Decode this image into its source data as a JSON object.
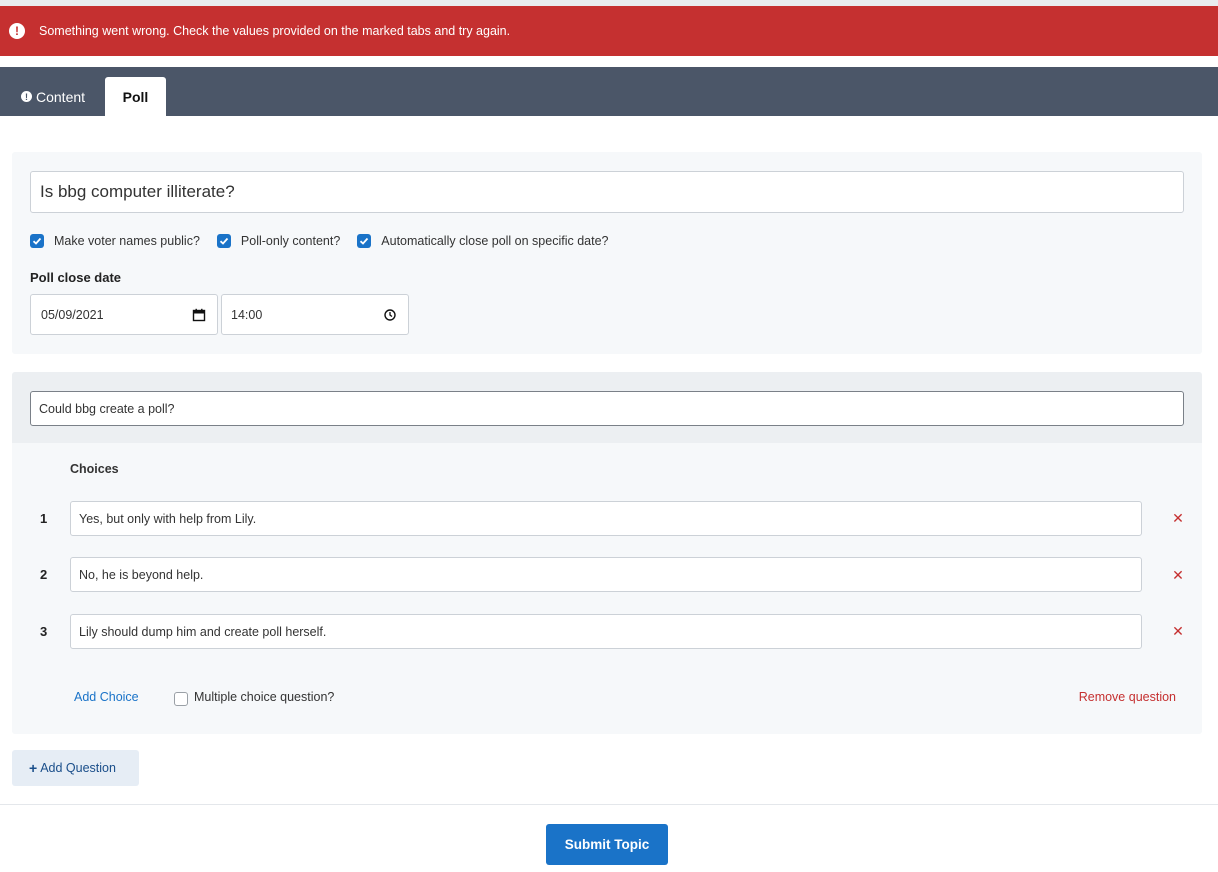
{
  "alert": {
    "message": "Something went wrong. Check the values provided on the marked tabs and try again."
  },
  "tabs": [
    {
      "label": "Content",
      "error": true
    },
    {
      "label": "Poll",
      "active": true
    }
  ],
  "poll": {
    "title": "Is bbg computer illiterate?",
    "options": [
      {
        "label": "Make voter names public?",
        "checked": true
      },
      {
        "label": "Poll-only content?",
        "checked": true
      },
      {
        "label": "Automatically close poll on specific date?",
        "checked": true
      }
    ],
    "close_date_label": "Poll close date",
    "close_date": "05/09/2021",
    "close_time": "14:00"
  },
  "question": {
    "text": "Could bbg create a poll?",
    "choices_label": "Choices",
    "choices": [
      {
        "num": "1",
        "text": "Yes, but only with help from Lily."
      },
      {
        "num": "2",
        "text": "No, he is beyond help."
      },
      {
        "num": "3",
        "text": "Lily should dump him and create poll herself."
      }
    ],
    "add_choice": "Add Choice",
    "multiple_choice_label": "Multiple choice question?",
    "multiple_choice_checked": false,
    "remove_question": "Remove question"
  },
  "add_question": "Add Question",
  "submit": "Submit Topic",
  "icons": {
    "alert": "exclamation-circle-icon",
    "check": "check-icon",
    "calendar": "calendar-icon",
    "clock": "clock-icon",
    "remove": "close-icon",
    "add": "plus-icon"
  },
  "colors": {
    "alert_bg": "#c53030",
    "tab_bar": "#4b5668",
    "accent": "#1a73c8",
    "danger": "#c53030"
  }
}
